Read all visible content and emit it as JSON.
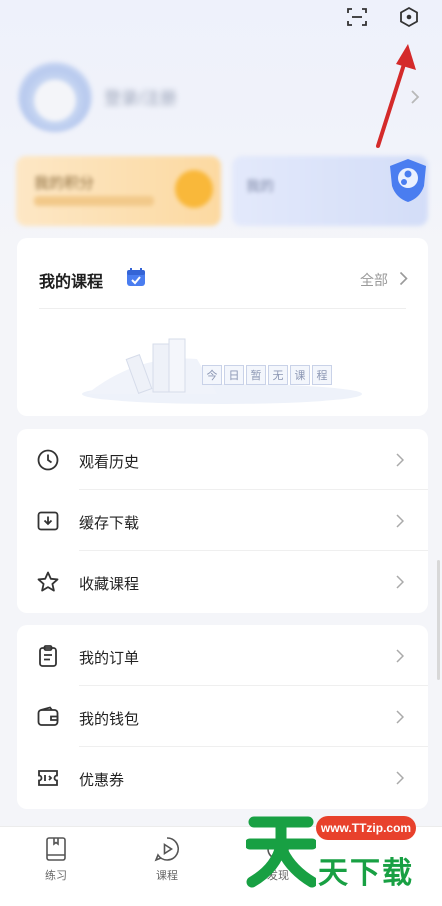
{
  "header": {
    "nickname": "登录/注册",
    "icons": [
      "scan-icon",
      "settings-icon"
    ]
  },
  "promo_cards": {
    "left_title": "我的积分",
    "right_title": "我的"
  },
  "courses": {
    "title": "我的课程",
    "all_label": "全部",
    "empty_chars": [
      "今",
      "日",
      "暂",
      "无",
      "课",
      "程"
    ]
  },
  "menu1": [
    {
      "label": "观看历史",
      "icon": "history-clock-icon"
    },
    {
      "label": "缓存下载",
      "icon": "download-icon"
    },
    {
      "label": "收藏课程",
      "icon": "star-icon"
    }
  ],
  "menu2": [
    {
      "label": "我的订单",
      "icon": "order-clipboard-icon"
    },
    {
      "label": "我的钱包",
      "icon": "wallet-icon"
    },
    {
      "label": "优惠券",
      "icon": "coupon-icon"
    }
  ],
  "tabbar": {
    "tabs": [
      {
        "label": "练习",
        "icon": "practice-book-icon"
      },
      {
        "label": "课程",
        "icon": "course-play-icon"
      },
      {
        "label": "发现",
        "icon": "discover-icon"
      }
    ]
  },
  "watermark": {
    "url": "www.TTzip.com",
    "text": "天下载",
    "big_char": "天"
  },
  "colors": {
    "background": "#f4f5f9",
    "card": "#ffffff",
    "accent_blue": "#4a7df0",
    "annotation_red": "#d42a2a",
    "watermark_green": "#18a043",
    "watermark_red": "#e8412c"
  }
}
